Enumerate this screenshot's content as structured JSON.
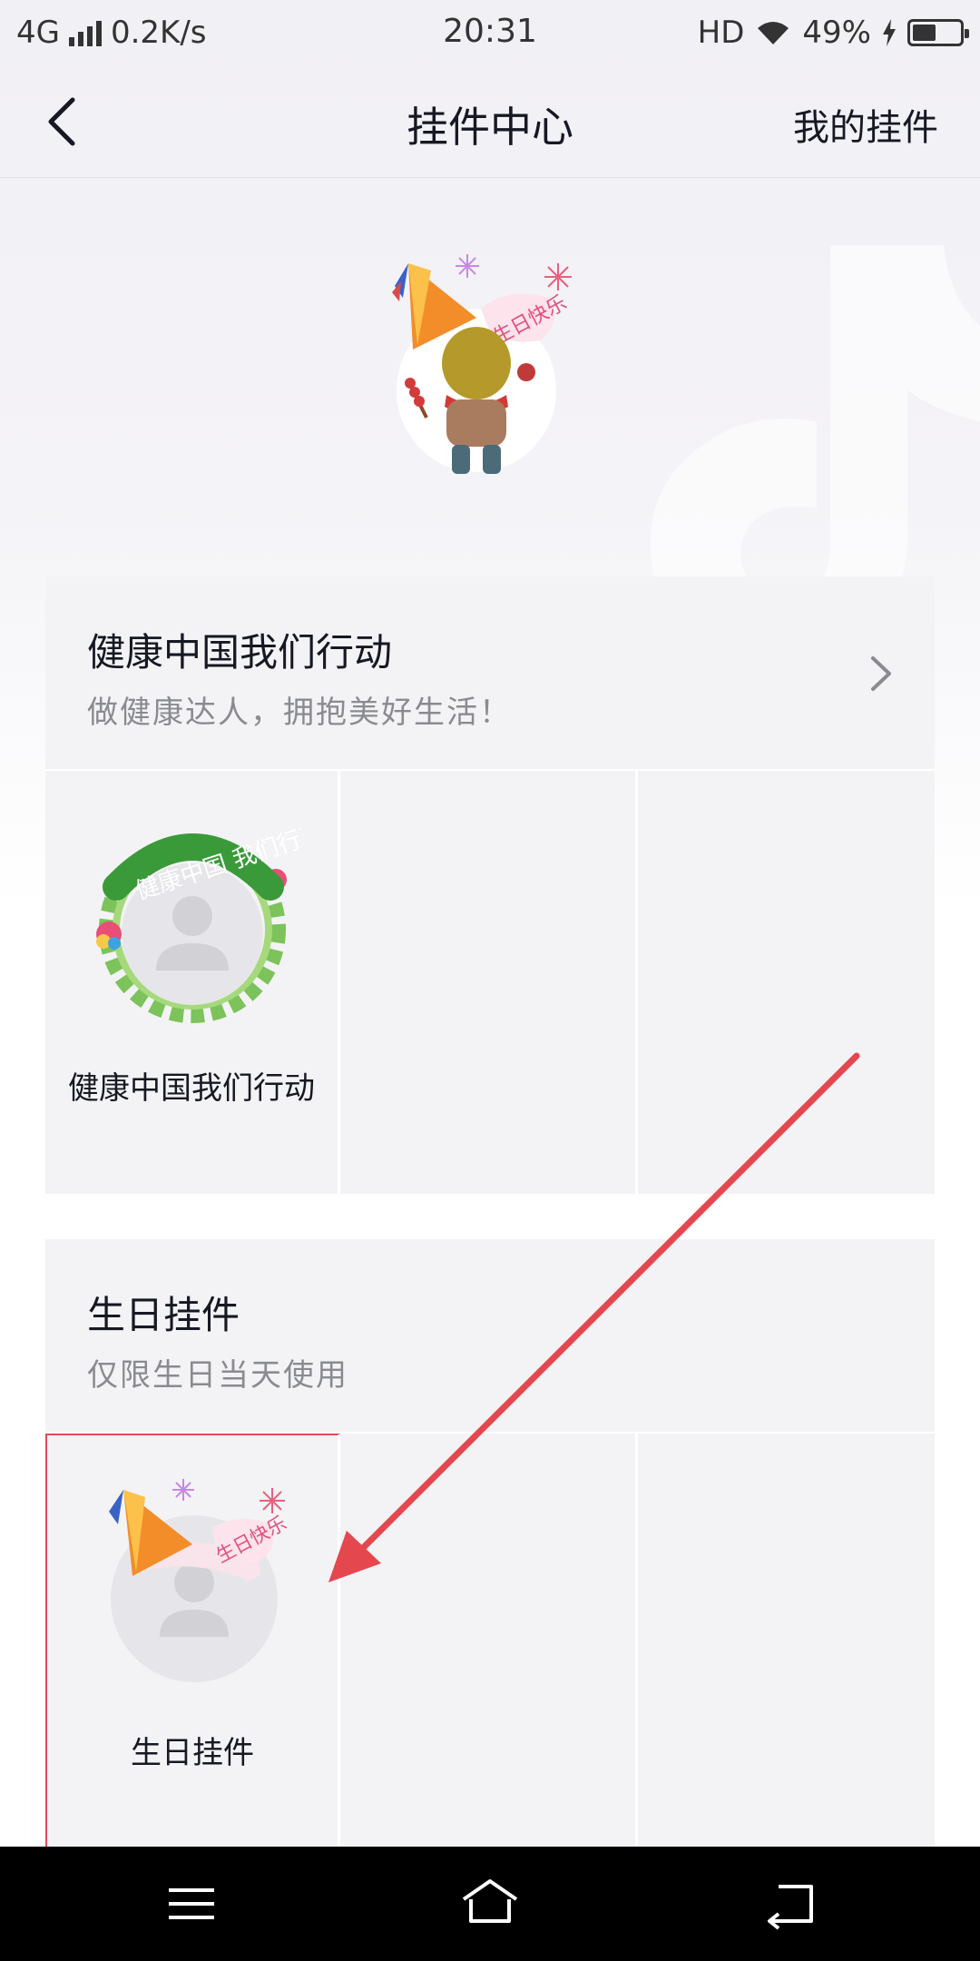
{
  "status_bar": {
    "network": "4G",
    "speed": "0.2K/s",
    "time": "20:31",
    "hd": "HD",
    "battery": "49%",
    "battery_level": 0.49
  },
  "header": {
    "title": "挂件中心",
    "right_action": "我的挂件"
  },
  "sections": [
    {
      "title": "健康中国我们行动",
      "subtitle": "做健康达人，拥抱美好生活！",
      "items": [
        {
          "label": "健康中国我们行动",
          "ring_text": "健康中国 我们行动"
        },
        {
          "label": ""
        },
        {
          "label": ""
        }
      ]
    },
    {
      "title": "生日挂件",
      "subtitle": "仅限生日当天使用",
      "items": [
        {
          "label": "生日挂件",
          "badge_text": "生日快乐",
          "selected": true
        },
        {
          "label": ""
        },
        {
          "label": ""
        }
      ]
    }
  ],
  "hero": {
    "badge_text": "生日快乐"
  },
  "colors": {
    "accent_red": "#e04a5a",
    "card_bg": "#f3f3f5",
    "subtitle_gray": "#8a8b91"
  },
  "icons": {
    "back": "chevron-left-icon",
    "section_arrow": "chevron-right-icon",
    "sys_menu": "menu-icon",
    "sys_home": "home-icon",
    "sys_back": "back-icon"
  }
}
